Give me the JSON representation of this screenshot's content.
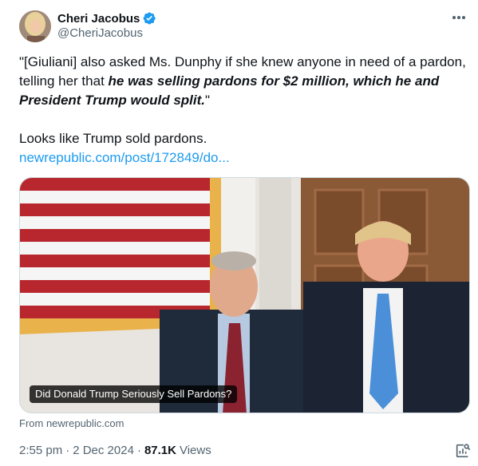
{
  "author": {
    "display_name": "Cheri Jacobus",
    "handle": "@CheriJacobus",
    "verified": true
  },
  "tweet": {
    "quote_open": "\"[Giuliani] also asked Ms. Dunphy if she knew anyone in need of a pardon, telling her that ",
    "quote_emphasis": "he was selling pardons for $2 million, which he and President Trump would split.",
    "quote_close": "\"",
    "comment": "Looks like Trump sold pardons.",
    "link": "newrepublic.com/post/172849/do..."
  },
  "card": {
    "caption": "Did Donald Trump Seriously Sell Pardons?",
    "source": "From newrepublic.com"
  },
  "meta": {
    "time": "2:55 pm",
    "date": "2 Dec 2024",
    "views_count": "87.1K",
    "views_label": "Views",
    "separator": "·"
  },
  "colors": {
    "link": "#1d9bf0",
    "verified": "#1d9bf0",
    "secondary_text": "#536471"
  },
  "icons": {
    "verified": "verified-badge-icon",
    "more": "more-horizontal-icon",
    "analytics": "analytics-icon"
  }
}
